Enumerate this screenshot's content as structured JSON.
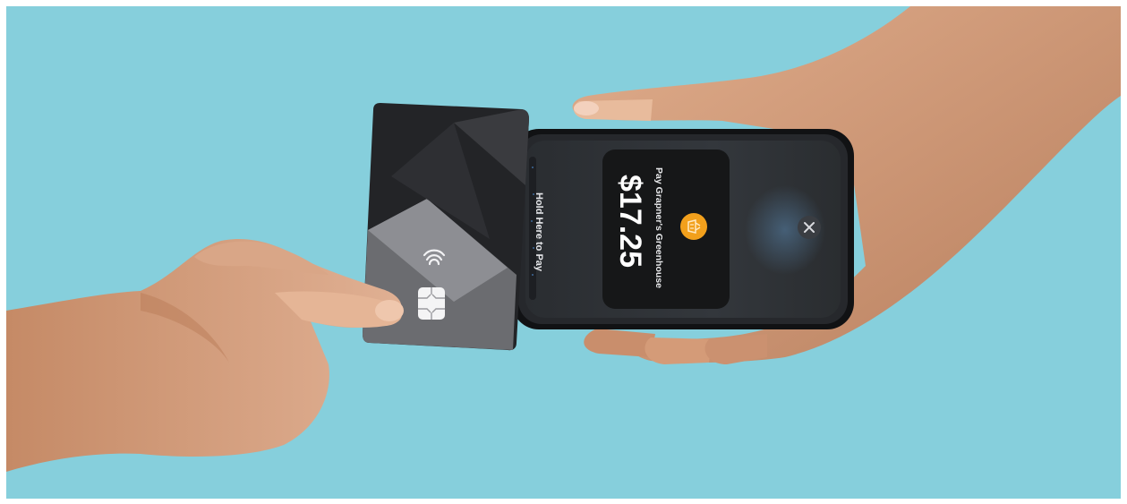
{
  "colors": {
    "background": "#86cfdc",
    "phone_body": "#1c1d20",
    "phone_screen": "#2c2f33",
    "card_dark": "#26272a",
    "card_mid": "#8f9095",
    "payment_panel": "#161718",
    "merchant_badge": "#f2a01c",
    "skin": "#d7a27f"
  },
  "phone_screen": {
    "hold_prompt": "Hold Here to Pay",
    "merchant_line": "Pay Grapner's Greenhouse",
    "amount": "$17.25",
    "merchant_icon": "basket-icon",
    "close_icon": "close-icon"
  },
  "card": {
    "contactless_icon": "contactless-icon",
    "chip_icon": "chip-icon"
  }
}
